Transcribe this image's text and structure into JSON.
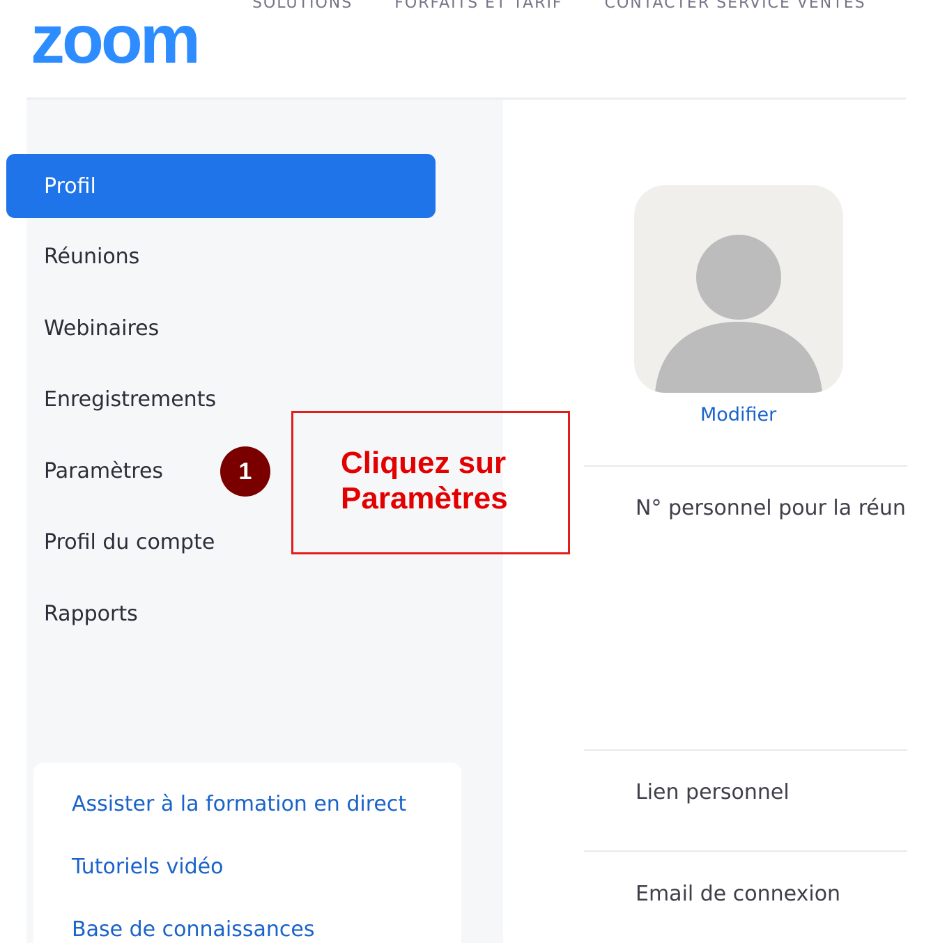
{
  "header": {
    "logo_text": "zoom",
    "nav_items": [
      "SOLUTIONS",
      "FORFAITS ET TARIF",
      "CONTACTER SERVICE VENTES"
    ]
  },
  "sidebar": {
    "items": [
      {
        "label": "Profil",
        "active": true
      },
      {
        "label": "Réunions"
      },
      {
        "label": "Webinaires"
      },
      {
        "label": "Enregistrements"
      },
      {
        "label": "Paramètres"
      },
      {
        "label": "Profil du compte"
      },
      {
        "label": "Rapports"
      }
    ],
    "step_badge": "1",
    "help_links": [
      "Assister à la formation en direct",
      "Tutoriels vidéo",
      "Base de connaissances"
    ]
  },
  "callout": {
    "line1": "Cliquez sur",
    "line2": "Paramètres"
  },
  "profile": {
    "modify_link": "Modifier",
    "fields": {
      "meeting_id_label": "N° personnel pour la réun",
      "personal_link_label": "Lien personnel",
      "login_email_label": "Email de connexion"
    }
  },
  "colors": {
    "brand_blue": "#2D8CFF",
    "active_item": "#1F74EA",
    "link_blue": "#1A63C9",
    "callout_red": "#E30000",
    "badge_dark_red": "#7A0000"
  }
}
